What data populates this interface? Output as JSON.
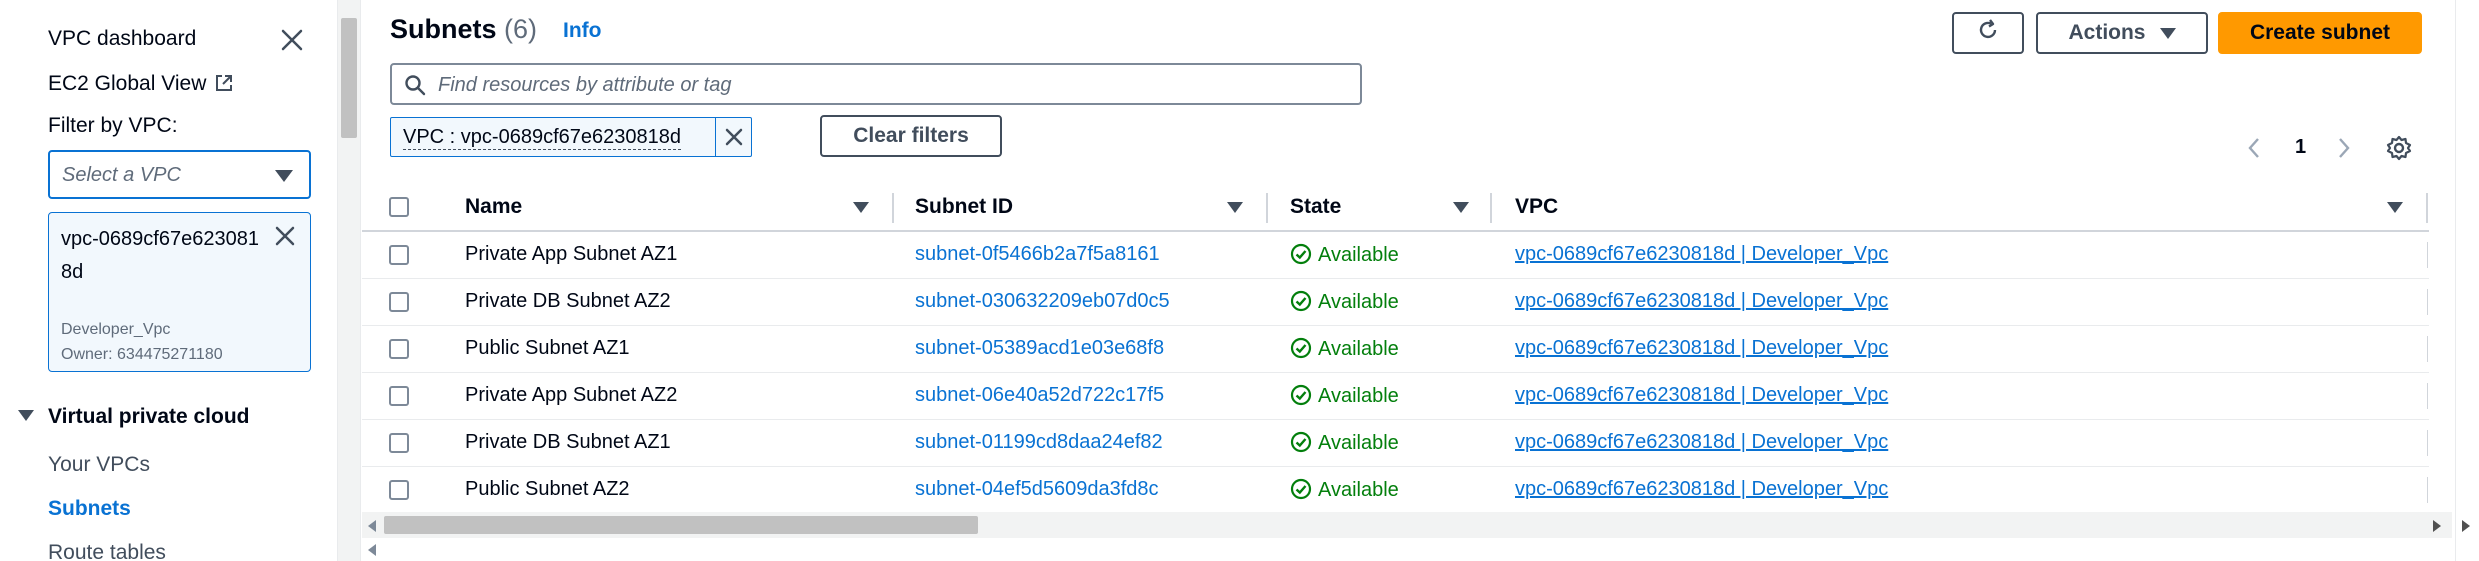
{
  "sidebar": {
    "dashboard_label": "VPC dashboard",
    "ec2_global_view_label": "EC2 Global View",
    "filter_label": "Filter by VPC:",
    "vpc_select_placeholder": "Select a VPC",
    "selected_vpc": {
      "id": "vpc-0689cf67e6230818d",
      "name": "Developer_Vpc",
      "owner": "Owner: 634475271180"
    },
    "section_title": "Virtual private cloud",
    "items": [
      {
        "label": "Your VPCs",
        "active": false
      },
      {
        "label": "Subnets",
        "active": true
      },
      {
        "label": "Route tables",
        "active": false
      }
    ]
  },
  "header": {
    "title": "Subnets",
    "count": "(6)",
    "info_label": "Info",
    "actions_label": "Actions",
    "create_label": "Create subnet"
  },
  "search": {
    "placeholder": "Find resources by attribute or tag"
  },
  "filter_chip": {
    "label": "VPC : vpc-0689cf67e6230818d"
  },
  "clear_filters_label": "Clear filters",
  "pagination": {
    "current_page": "1"
  },
  "table": {
    "columns": [
      "Name",
      "Subnet ID",
      "State",
      "VPC"
    ],
    "rows": [
      {
        "name": "Private App Subnet AZ1",
        "subnet_id": "subnet-0f5466b2a7f5a8161",
        "state": "Available",
        "vpc": "vpc-0689cf67e6230818d | Developer_Vpc"
      },
      {
        "name": "Private DB Subnet AZ2",
        "subnet_id": "subnet-030632209eb07d0c5",
        "state": "Available",
        "vpc": "vpc-0689cf67e6230818d | Developer_Vpc"
      },
      {
        "name": "Public Subnet AZ1",
        "subnet_id": "subnet-05389acd1e03e68f8",
        "state": "Available",
        "vpc": "vpc-0689cf67e6230818d | Developer_Vpc"
      },
      {
        "name": "Private App Subnet AZ2",
        "subnet_id": "subnet-06e40a52d722c17f5",
        "state": "Available",
        "vpc": "vpc-0689cf67e6230818d | Developer_Vpc"
      },
      {
        "name": "Private DB Subnet AZ1",
        "subnet_id": "subnet-01199cd8daa24ef82",
        "state": "Available",
        "vpc": "vpc-0689cf67e6230818d | Developer_Vpc"
      },
      {
        "name": "Public Subnet AZ2",
        "subnet_id": "subnet-04ef5d5609da3fd8c",
        "state": "Available",
        "vpc": "vpc-0689cf67e6230818d | Developer_Vpc"
      }
    ]
  },
  "colors": {
    "link": "#0972d3",
    "primary_button": "#ff9900",
    "status_available": "#037f0c",
    "text": "#000716"
  },
  "icons": [
    "close-icon",
    "external-link-icon",
    "chevron-down-icon",
    "refresh-icon",
    "search-icon",
    "chevron-left-icon",
    "chevron-right-icon",
    "settings-gear-icon",
    "status-available-icon"
  ]
}
